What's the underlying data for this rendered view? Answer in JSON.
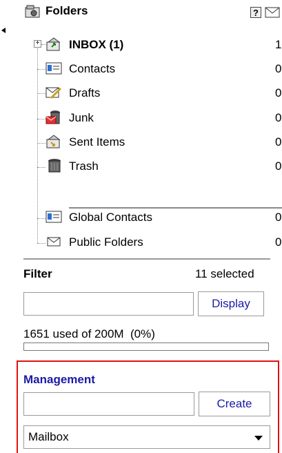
{
  "header": {
    "title": "Folders",
    "help_label": "?"
  },
  "folders": [
    {
      "label": "INBOX (1)",
      "count": "1",
      "icon": "inbox-icon",
      "bold": true
    },
    {
      "label": "Contacts",
      "count": "0",
      "icon": "contacts-icon"
    },
    {
      "label": "Drafts",
      "count": "0",
      "icon": "drafts-icon"
    },
    {
      "label": "Junk",
      "count": "0",
      "icon": "junk-icon"
    },
    {
      "label": "Sent Items",
      "count": "0",
      "icon": "sent-items-icon"
    },
    {
      "label": "Trash",
      "count": "0",
      "icon": "trash-icon"
    }
  ],
  "shared": [
    {
      "label": "Global Contacts",
      "count": "0",
      "icon": "contacts-icon"
    },
    {
      "label": "Public Folders",
      "count": "0",
      "icon": "envelope-icon"
    }
  ],
  "filter": {
    "label": "Filter",
    "selected_text": "11 selected",
    "input_value": "",
    "button_label": "Display"
  },
  "quota": {
    "text": "1651 used of 200M  (0%)",
    "fraction": 0
  },
  "management": {
    "title": "Management",
    "input_value": "",
    "button_label": "Create",
    "select_value": "Mailbox"
  },
  "colors": {
    "highlight_border": "#e01010",
    "link_blue": "#1a1aa6"
  }
}
